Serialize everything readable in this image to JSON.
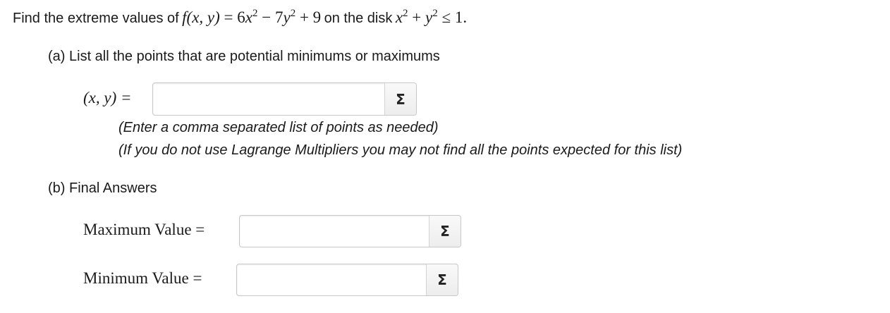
{
  "question": {
    "prefix": "Find the extreme values of",
    "function": {
      "f": "f",
      "args": "(x, y)",
      "eq": " = ",
      "t1_coef": "6",
      "t1_var": "x",
      "t1_exp": "2",
      "op1": " − ",
      "t2_coef": "7",
      "t2_var": "y",
      "t2_exp": "2",
      "op2": " + ",
      "const": "9"
    },
    "middle": "on the disk",
    "region": {
      "v1": "x",
      "e1": "2",
      "op": " + ",
      "v2": "y",
      "e2": "2",
      "rel": " ≤ ",
      "bound": "1."
    }
  },
  "part_a": {
    "label": "(a) List all the points that are potential minimums or maximums",
    "prompt": "(x, y) =",
    "value": "",
    "hint1": "(Enter a comma separated list of points as needed)",
    "hint2": "(If you do not use Lagrange Multipliers you may not find all the points expected for this list)",
    "sigma": "Σ"
  },
  "part_b": {
    "label": "(b) Final Answers",
    "max_label": "Maximum Value =",
    "max_value": "",
    "min_label": "Minimum Value =",
    "min_value": "",
    "sigma": "Σ"
  }
}
